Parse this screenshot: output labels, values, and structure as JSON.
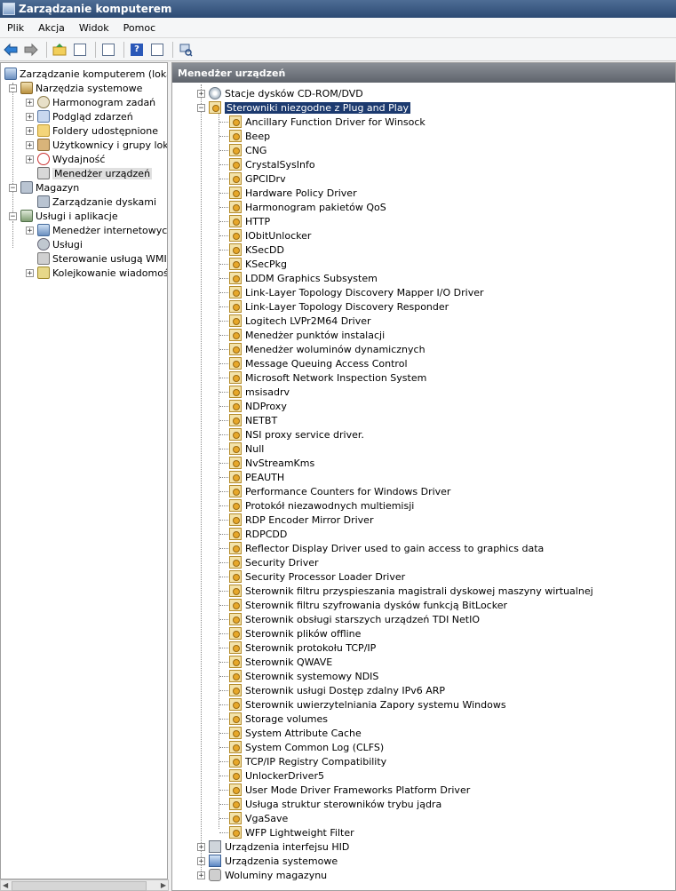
{
  "window": {
    "title": "Zarządzanie komputerem"
  },
  "menu": [
    "Plik",
    "Akcja",
    "Widok",
    "Pomoc"
  ],
  "toolbar": {
    "icons": [
      "back-arrow-icon",
      "forward-arrow-icon",
      "up-folder-icon",
      "show-hide-tree-icon",
      "properties-icon",
      "help-icon",
      "action-pane-icon",
      "scan-hardware-icon"
    ],
    "help_glyph": "?"
  },
  "left_tree": {
    "root": "Zarządzanie komputerem (lokalne)",
    "items": [
      {
        "label": "Narzędzia systemowe"
      },
      {
        "label": "Harmonogram zadań"
      },
      {
        "label": "Podgląd zdarzeń"
      },
      {
        "label": "Foldery udostępnione"
      },
      {
        "label": "Użytkownicy i grupy lokalne"
      },
      {
        "label": "Wydajność"
      },
      {
        "label": "Menedżer urządzeń"
      },
      {
        "label": "Magazyn"
      },
      {
        "label": "Zarządzanie dyskami"
      },
      {
        "label": "Usługi i aplikacje"
      },
      {
        "label": "Menedżer internetowych usług informacyjnych (IIS)"
      },
      {
        "label": "Usługi"
      },
      {
        "label": "Sterowanie usługą WMI"
      },
      {
        "label": "Kolejkowanie wiadomości"
      }
    ]
  },
  "right_pane": {
    "header": "Menedżer urządzeń",
    "top_category": "Stacje dysków CD-ROM/DVD",
    "selected_category": "Sterowniki niezgodne z Plug and Play",
    "drivers": [
      "Ancillary Function Driver for Winsock",
      "Beep",
      "CNG",
      "CrystalSysInfo",
      "GPCIDrv",
      "Hardware Policy Driver",
      "Harmonogram pakietów QoS",
      "HTTP",
      "IObitUnlocker",
      "KSecDD",
      "KSecPkg",
      "LDDM Graphics Subsystem",
      "Link-Layer Topology Discovery Mapper I/O Driver",
      "Link-Layer Topology Discovery Responder",
      "Logitech LVPr2M64 Driver",
      "Menedżer punktów instalacji",
      "Menedżer woluminów dynamicznych",
      "Message Queuing Access Control",
      "Microsoft Network Inspection System",
      "msisadrv",
      "NDProxy",
      "NETBT",
      "NSI proxy service driver.",
      "Null",
      "NvStreamKms",
      "PEAUTH",
      "Performance Counters for Windows Driver",
      "Protokół niezawodnych multiemisji",
      "RDP Encoder Mirror Driver",
      "RDPCDD",
      "Reflector Display Driver used to gain access to graphics data",
      "Security Driver",
      "Security Processor Loader Driver",
      "Sterownik filtru przyspieszania magistrali dyskowej maszyny wirtualnej",
      "Sterownik filtru szyfrowania dysków funkcją BitLocker",
      "Sterownik obsługi starszych urządzeń TDI NetIO",
      "Sterownik plików offline",
      "Sterownik protokołu TCP/IP",
      "Sterownik QWAVE",
      "Sterownik systemowy NDIS",
      "Sterownik usługi Dostęp zdalny IPv6 ARP",
      "Sterownik uwierzytelniania Zapory systemu Windows",
      "Storage volumes",
      "System Attribute Cache",
      "System Common Log (CLFS)",
      "TCP/IP Registry Compatibility",
      "UnlockerDriver5",
      "User Mode Driver Frameworks Platform Driver",
      "Usługa struktur sterowników trybu jądra",
      "VgaSave",
      "WFP Lightweight Filter"
    ],
    "bottom_categories": [
      {
        "label": "Urządzenia interfejsu HID",
        "icon": "hid"
      },
      {
        "label": "Urządzenia systemowe",
        "icon": "sys"
      },
      {
        "label": "Woluminy magazynu",
        "icon": "vol"
      }
    ]
  }
}
